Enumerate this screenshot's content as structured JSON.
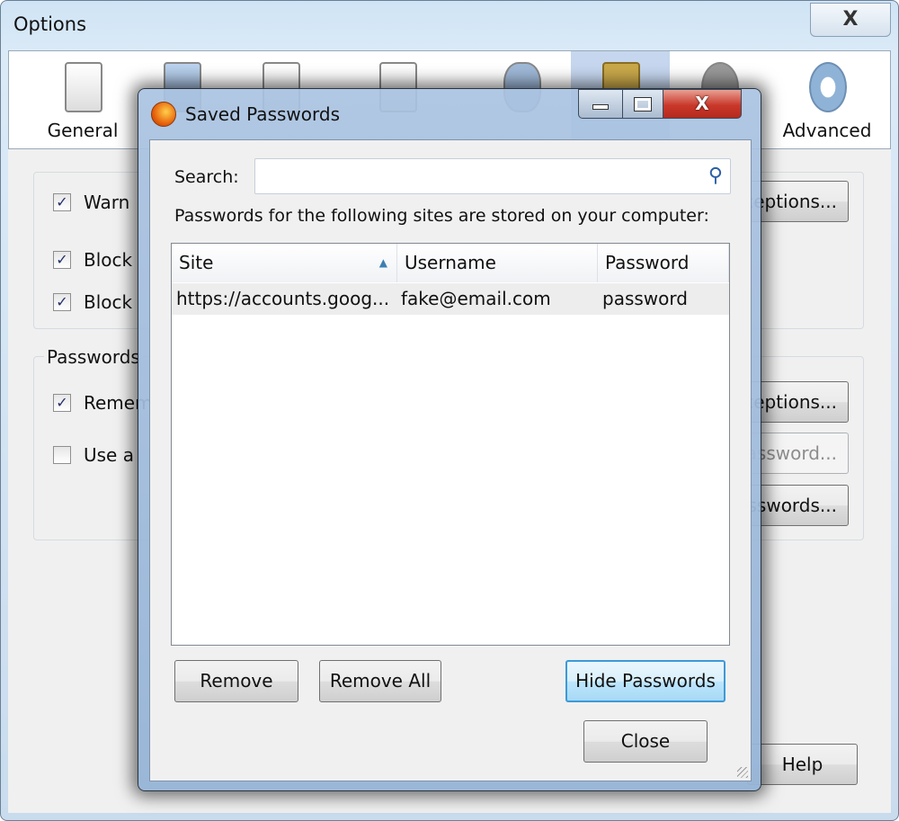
{
  "options_window": {
    "title": "Options",
    "close_label": "X",
    "toolbar": [
      {
        "label": "General",
        "icon": "switch-icon"
      },
      {
        "label": "",
        "icon": "tabs-icon"
      },
      {
        "label": "",
        "icon": "content-icon"
      },
      {
        "label": "",
        "icon": "applications-icon"
      },
      {
        "label": "",
        "icon": "privacy-mask-icon"
      },
      {
        "label": "",
        "icon": "security-lock-icon",
        "selected": true
      },
      {
        "label": "",
        "icon": "sync-icon"
      },
      {
        "label": "Advanced",
        "icon": "gear-icon"
      }
    ],
    "security_group": {
      "checkboxes": [
        {
          "label": "Warn",
          "checked": true
        },
        {
          "label": "Block",
          "checked": true
        },
        {
          "label": "Block",
          "checked": true
        }
      ],
      "exceptions_label": "Exceptions..."
    },
    "passwords_group": {
      "legend": "Passwords",
      "checkboxes": [
        {
          "label": "Remem",
          "checked": true
        },
        {
          "label": "Use a",
          "checked": false
        }
      ],
      "exceptions_label": "Exceptions...",
      "master_password_label": "Change Master Password...",
      "saved_passwords_label": "Saved Passwords..."
    },
    "help_label": "Help"
  },
  "dialog": {
    "title": "Saved Passwords",
    "search_label": "Search:",
    "search_value": "",
    "info_text": "Passwords for the following sites are stored on your computer:",
    "columns": [
      "Site",
      "Username",
      "Password"
    ],
    "sort_column": "Site",
    "rows": [
      {
        "site": "https://accounts.goog...",
        "username": "fake@email.com",
        "password": "password"
      }
    ],
    "remove_label": "Remove",
    "remove_all_label": "Remove All",
    "hide_passwords_label": "Hide Passwords",
    "close_label": "Close"
  },
  "colors": {
    "accent": "#2b5ea8",
    "close_red": "#c9382b",
    "selected_tab": "#c5d6ee"
  }
}
